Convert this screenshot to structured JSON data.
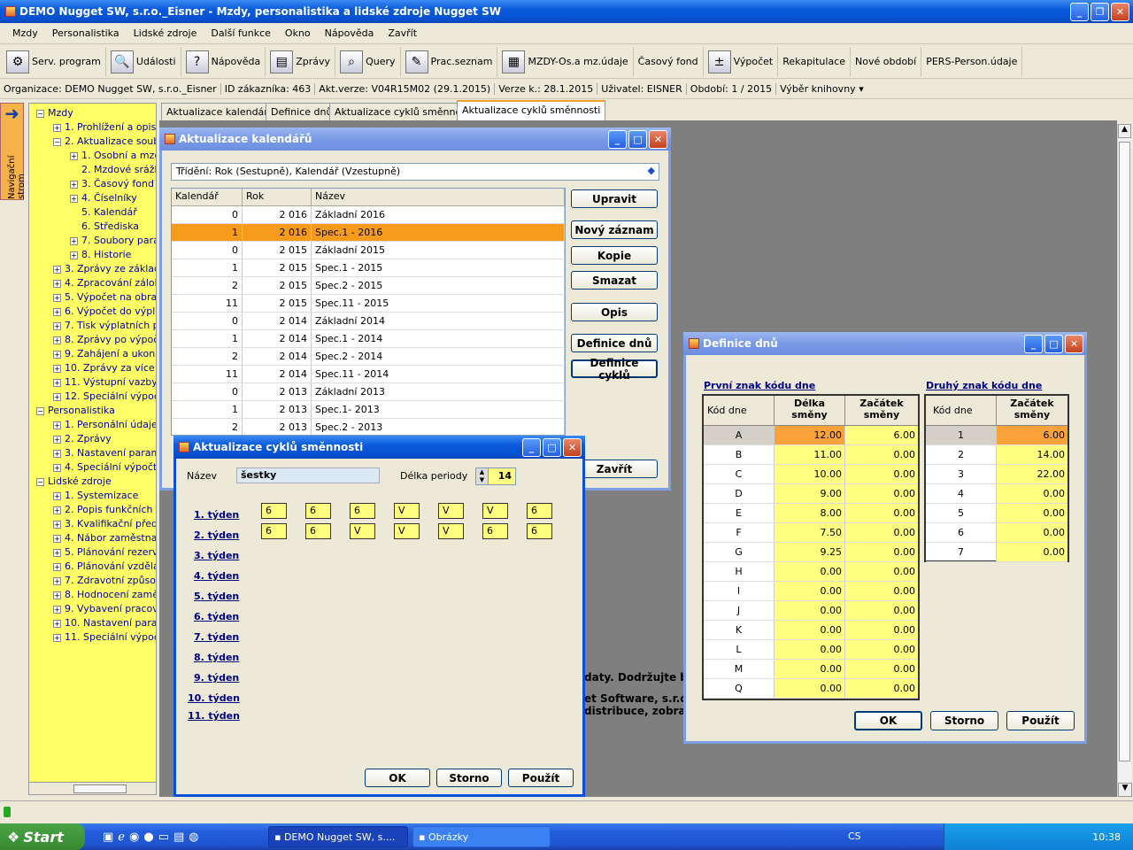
{
  "app": {
    "title": "DEMO Nugget SW, s.r.o._Eisner - Mzdy, personalistika a lidské zdroje Nugget SW"
  },
  "menu": [
    "Mzdy",
    "Personalistika",
    "Lidské zdroje",
    "Další funkce",
    "Okno",
    "Nápověda",
    "Zavřít"
  ],
  "toolbar": [
    "Serv. program",
    "Události",
    "Nápověda",
    "Zprávy",
    "Query",
    "Prac.seznam",
    "MZDY-Os.a mz.údaje",
    "Časový fond",
    "Výpočet",
    "Rekapitulace",
    "Nové období",
    "PERS-Person.údaje"
  ],
  "status": {
    "org": "Organizace: DEMO Nugget SW, s.r.o._Eisner",
    "customer": "ID zákazníka: 463",
    "version": "Akt.verze: V04R15M02 (29.1.2015)",
    "verze_k": "Verze k.: 28.1.2015",
    "user": "Uživatel: EISNER",
    "period": "Období: 1 / 2015",
    "book": "Výběr knihovny"
  },
  "nav_strip": "Navigační strom",
  "tree": [
    {
      "level": 0,
      "pm": "−",
      "label": "Mzdy"
    },
    {
      "level": 1,
      "pm": "+",
      "label": "1. Prohlížení a opis"
    },
    {
      "level": 1,
      "pm": "−",
      "label": "2. Aktualizace soubo"
    },
    {
      "level": 2,
      "pm": "+",
      "label": "1. Osobní a mzd"
    },
    {
      "level": 2,
      "pm": "",
      "label": "2. Mzdové srážk"
    },
    {
      "level": 2,
      "pm": "+",
      "label": "3. Časový fond"
    },
    {
      "level": 2,
      "pm": "+",
      "label": "4. Číselníky"
    },
    {
      "level": 2,
      "pm": "",
      "label": "5. Kalendář"
    },
    {
      "level": 2,
      "pm": "",
      "label": "6. Střediska"
    },
    {
      "level": 2,
      "pm": "+",
      "label": "7. Soubory parar"
    },
    {
      "level": 2,
      "pm": "+",
      "label": "8. Historie"
    },
    {
      "level": 1,
      "pm": "+",
      "label": "3. Zprávy ze základr"
    },
    {
      "level": 1,
      "pm": "+",
      "label": "4. Zpracování záloh"
    },
    {
      "level": 1,
      "pm": "+",
      "label": "5. Výpočet na obraz"
    },
    {
      "level": 1,
      "pm": "+",
      "label": "6. Výpočet do výplat"
    },
    {
      "level": 1,
      "pm": "+",
      "label": "7. Tisk výplatních pá"
    },
    {
      "level": 1,
      "pm": "+",
      "label": "8. Zprávy po výpočt"
    },
    {
      "level": 1,
      "pm": "+",
      "label": "9. Zahájení a ukonč"
    },
    {
      "level": 1,
      "pm": "+",
      "label": "10. Zprávy za více c"
    },
    {
      "level": 1,
      "pm": "+",
      "label": "11. Výstupní vazby"
    },
    {
      "level": 1,
      "pm": "+",
      "label": "12. Speciální výpočt"
    },
    {
      "level": 0,
      "pm": "−",
      "label": "Personalistika"
    },
    {
      "level": 1,
      "pm": "+",
      "label": "1. Personální údaje"
    },
    {
      "level": 1,
      "pm": "+",
      "label": "2. Zprávy"
    },
    {
      "level": 1,
      "pm": "+",
      "label": "3. Nastavení parame"
    },
    {
      "level": 1,
      "pm": "+",
      "label": "4. Speciální výpočty"
    },
    {
      "level": 0,
      "pm": "−",
      "label": "Lidské zdroje"
    },
    {
      "level": 1,
      "pm": "+",
      "label": "1. Systemizace"
    },
    {
      "level": 1,
      "pm": "+",
      "label": "2. Popis funkčních n"
    },
    {
      "level": 1,
      "pm": "+",
      "label": "3. Kvalifikační předp"
    },
    {
      "level": 1,
      "pm": "+",
      "label": "4. Nábor zaměstnan"
    },
    {
      "level": 1,
      "pm": "+",
      "label": "5. Plánování rezerv"
    },
    {
      "level": 1,
      "pm": "+",
      "label": "6. Plánování vzdělá"
    },
    {
      "level": 1,
      "pm": "+",
      "label": "7. Zdravotní způsob"
    },
    {
      "level": 1,
      "pm": "+",
      "label": "8. Hodnocení zaměs"
    },
    {
      "level": 1,
      "pm": "+",
      "label": "9. Vybavení pracovi"
    },
    {
      "level": 1,
      "pm": "+",
      "label": "10. Nastavení paran"
    },
    {
      "level": 1,
      "pm": "+",
      "label": "11. Speciální výpočt"
    }
  ],
  "tabs": [
    "Aktualizace kalendářů",
    "Definice dnů",
    "Aktualizace cyklů směnnosti",
    "Aktualizace cyklů směnnosti"
  ],
  "cal": {
    "title": "Aktualizace kalendářů",
    "sort": "Třídění: Rok (Sestupně), Kalendář (Vzestupně)",
    "headers": [
      "Kalendář",
      "Rok",
      "Název"
    ],
    "rows": [
      [
        "0",
        "2 016",
        "Základní 2016"
      ],
      [
        "1",
        "2 016",
        "Spec.1 - 2016"
      ],
      [
        "0",
        "2 015",
        "Základní 2015"
      ],
      [
        "1",
        "2 015",
        "Spec.1 - 2015"
      ],
      [
        "2",
        "2 015",
        "Spec.2 - 2015"
      ],
      [
        "11",
        "2 015",
        "Spec.11 - 2015"
      ],
      [
        "0",
        "2 014",
        "Základní 2014"
      ],
      [
        "1",
        "2 014",
        "Spec.1 - 2014"
      ],
      [
        "2",
        "2 014",
        "Spec.2 - 2014"
      ],
      [
        "11",
        "2 014",
        "Spec.11 - 2014"
      ],
      [
        "0",
        "2 013",
        "Základní 2013"
      ],
      [
        "1",
        "2 013",
        "Spec.1- 2013"
      ],
      [
        "2",
        "2 013",
        "Spec.2 - 2013"
      ]
    ],
    "buttons": [
      "Upravit",
      "Nový záznam",
      "Kopie",
      "Smazat",
      "Opis",
      "Definice dnů",
      "Definice cyklů",
      "Zavřít"
    ]
  },
  "cyc": {
    "title": "Aktualizace cyklů směnnosti",
    "name_label": "Název",
    "name_value": "šestky",
    "period_label": "Délka periody",
    "period_value": "14",
    "weeks": [
      "1. týden",
      "2. týden",
      "3. týden",
      "4. týden",
      "5. týden",
      "6. týden",
      "7. týden",
      "8. týden",
      "9. týden",
      "10. týden",
      "11. týden"
    ],
    "week1": [
      "6",
      "6",
      "6",
      "V",
      "V",
      "V",
      "6"
    ],
    "week2": [
      "6",
      "6",
      "V",
      "V",
      "V",
      "6",
      "6"
    ],
    "ok": "OK",
    "storno": "Storno",
    "pouzit": "Použít"
  },
  "def": {
    "title": "Definice dnů",
    "first_label": "První znak kódu dne",
    "second_label": "Druhý znak kódu dne",
    "h_code": "Kód dne",
    "h_len": "Délka směny",
    "h_start": "Začátek směny",
    "first": [
      [
        "A",
        "12.00",
        "6.00"
      ],
      [
        "B",
        "11.00",
        "0.00"
      ],
      [
        "C",
        "10.00",
        "0.00"
      ],
      [
        "D",
        "9.00",
        "0.00"
      ],
      [
        "E",
        "8.00",
        "0.00"
      ],
      [
        "F",
        "7.50",
        "0.00"
      ],
      [
        "G",
        "9.25",
        "0.00"
      ],
      [
        "H",
        "0.00",
        "0.00"
      ],
      [
        "I",
        "0.00",
        "0.00"
      ],
      [
        "J",
        "0.00",
        "0.00"
      ],
      [
        "K",
        "0.00",
        "0.00"
      ],
      [
        "L",
        "0.00",
        "0.00"
      ],
      [
        "M",
        "0.00",
        "0.00"
      ],
      [
        "Q",
        "0.00",
        "0.00"
      ]
    ],
    "second": [
      [
        "1",
        "6.00"
      ],
      [
        "2",
        "14.00"
      ],
      [
        "3",
        "22.00"
      ],
      [
        "4",
        "0.00"
      ],
      [
        "5",
        "0.00"
      ],
      [
        "6",
        "0.00"
      ],
      [
        "7",
        "0.00"
      ]
    ],
    "ok": "OK",
    "storno": "Storno",
    "pouzit": "Použít"
  },
  "bg_text": {
    "l1": "daty. Dodržujte bo",
    "l2": "et Software, s.r.o",
    "l3": "distribuce, zobra"
  },
  "taskbar": {
    "start": "Start",
    "task1": "DEMO Nugget SW, s....",
    "task2": "Obrázky",
    "lang": "CS",
    "time": "10:38"
  }
}
